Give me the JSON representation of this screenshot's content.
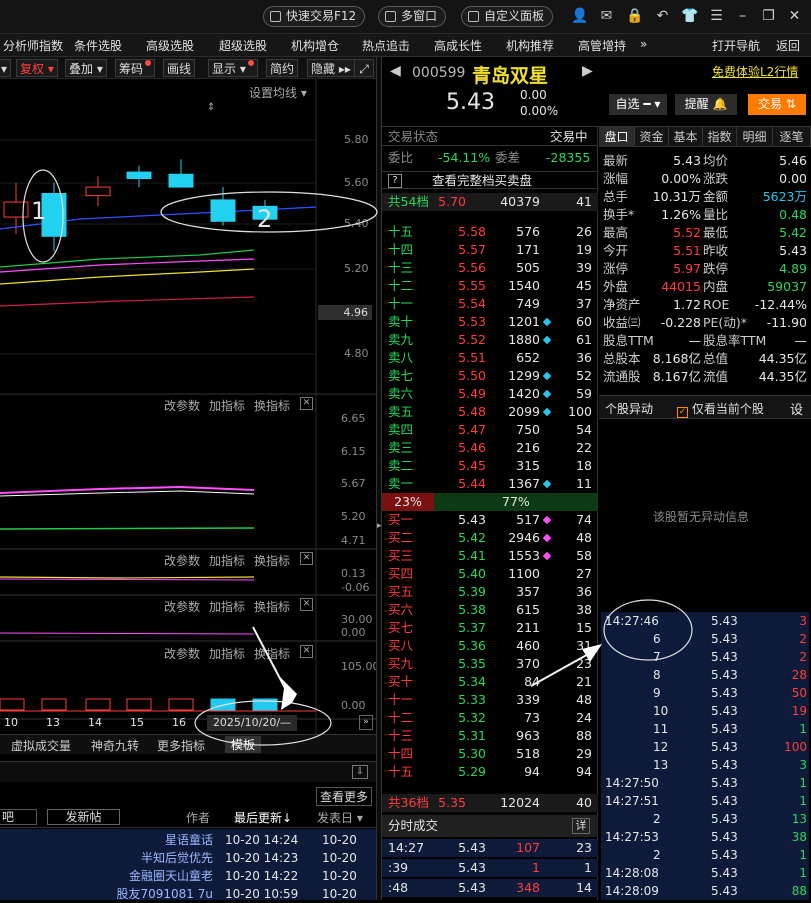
{
  "topbar": {
    "quick_trade": "快速交易F12",
    "multi_window": "多窗口",
    "custom_panel": "自定义面板"
  },
  "menu": {
    "items": [
      "分析师指数",
      "条件选股",
      "高级选股",
      "超级选股",
      "机构增仓",
      "热点追击",
      "高成长性",
      "机构推荐",
      "高管增持"
    ],
    "more": "»",
    "open_nav": "打开导航",
    "back": "返回"
  },
  "charttool": {
    "fq": "复权",
    "overlay": "叠加",
    "chip": "筹码",
    "draw": "画线",
    "display": "显示",
    "simple": "简约",
    "hide": "隐藏",
    "settings_ma": "设置均线"
  },
  "chart": {
    "price_ticks": [
      "5.80",
      "5.60",
      "5.40",
      "5.20",
      "5.00",
      "4.80"
    ],
    "current_price_tag": "4.96",
    "annot1": "1",
    "annot2": "2",
    "panel_buttons": {
      "params": "改参数",
      "add_indicator": "加指标",
      "switch_indicator": "换指标",
      "close": "✕"
    },
    "p2_ticks": [
      "6.65",
      "6.15",
      "5.67",
      "5.20",
      "4.71"
    ],
    "p3_ticks": [
      "0.13",
      "-0.06"
    ],
    "p4_ticks": [
      "30.00",
      "0.00"
    ],
    "p5_ticks": [
      "105.00",
      "0.00"
    ],
    "x_labels": [
      "10",
      "13",
      "14",
      "15",
      "16"
    ],
    "date_tag": "2025/10/20/—",
    "bottom_tabs": [
      "虚拟成交量",
      "神奇九转",
      "更多指标",
      "模板"
    ],
    "candles": [
      {
        "o": 5.44,
        "c": 5.51,
        "h": 5.6,
        "l": 5.36
      },
      {
        "o": 5.55,
        "c": 5.35,
        "h": 5.6,
        "l": 5.28
      },
      {
        "o": 5.54,
        "c": 5.58,
        "h": 5.63,
        "l": 5.49
      },
      {
        "o": 5.65,
        "c": 5.62,
        "h": 5.68,
        "l": 5.58
      },
      {
        "o": 5.64,
        "c": 5.58,
        "h": 5.71,
        "l": 5.58
      },
      {
        "o": 5.52,
        "c": 5.42,
        "h": 5.58,
        "l": 5.4
      },
      {
        "o": 5.49,
        "c": 5.43,
        "h": 5.52,
        "l": 5.42
      }
    ]
  },
  "stock": {
    "code": "000599",
    "name": "青岛双星",
    "price": "5.43",
    "change": "0.00",
    "pct": "0.00%",
    "l2": "免费体验L2行情",
    "watch": "自选",
    "remind": "提醒",
    "trade": "交易"
  },
  "ob": {
    "status_label": "交易状态",
    "status_val": "交易中",
    "weibi_label": "委比",
    "weibi": "-54.11%",
    "weicha_label": "委差",
    "weicha": "-28355",
    "full_link": "查看完整档买卖盘",
    "ask_total": {
      "label": "共54档",
      "price": "5.70",
      "vol": "40379",
      "n": "41"
    },
    "asks": [
      [
        "十五",
        "5.58",
        "576",
        "26"
      ],
      [
        "十四",
        "5.57",
        "171",
        "19"
      ],
      [
        "十三",
        "5.56",
        "505",
        "39"
      ],
      [
        "十二",
        "5.55",
        "1540",
        "45"
      ],
      [
        "十一",
        "5.54",
        "749",
        "37"
      ],
      [
        "卖十",
        "5.53",
        "1201",
        "60"
      ],
      [
        "卖九",
        "5.52",
        "1880",
        "61"
      ],
      [
        "卖八",
        "5.51",
        "652",
        "36"
      ],
      [
        "卖七",
        "5.50",
        "1299",
        "52"
      ],
      [
        "卖六",
        "5.49",
        "1420",
        "59"
      ],
      [
        "卖五",
        "5.48",
        "2099",
        "100"
      ],
      [
        "卖四",
        "5.47",
        "750",
        "54"
      ],
      [
        "卖三",
        "5.46",
        "216",
        "22"
      ],
      [
        "卖二",
        "5.45",
        "315",
        "18"
      ],
      [
        "卖一",
        "5.44",
        "1367",
        "11"
      ]
    ],
    "ratio_bid": "23%",
    "ratio_ask": "77%",
    "bids": [
      [
        "买一",
        "5.43",
        "517",
        "74"
      ],
      [
        "买二",
        "5.42",
        "2946",
        "48"
      ],
      [
        "买三",
        "5.41",
        "1553",
        "58"
      ],
      [
        "买四",
        "5.40",
        "1100",
        "27"
      ],
      [
        "买五",
        "5.39",
        "357",
        "36"
      ],
      [
        "买六",
        "5.38",
        "615",
        "38"
      ],
      [
        "买七",
        "5.37",
        "211",
        "15"
      ],
      [
        "买八",
        "5.36",
        "460",
        "31"
      ],
      [
        "买九",
        "5.35",
        "370",
        "23"
      ],
      [
        "买十",
        "5.34",
        "84",
        "21"
      ],
      [
        "十一",
        "5.33",
        "339",
        "48"
      ],
      [
        "十二",
        "5.32",
        "73",
        "24"
      ],
      [
        "十三",
        "5.31",
        "963",
        "88"
      ],
      [
        "十四",
        "5.30",
        "518",
        "29"
      ],
      [
        "十五",
        "5.29",
        "94",
        "94"
      ]
    ],
    "bid_total": {
      "label": "共36档",
      "price": "5.35",
      "vol": "12024",
      "n": "40"
    },
    "fenshi_label": "分时成交",
    "fenshi_detail": "详",
    "fenshi": [
      [
        "14:27",
        "5.43",
        "107",
        "23"
      ],
      [
        ":39",
        "5.43",
        "1",
        "1"
      ],
      [
        ":48",
        "5.43",
        "348",
        "14"
      ]
    ]
  },
  "rp": {
    "tabs": [
      "盘口",
      "资金",
      "基本",
      "指数",
      "明细",
      "逐笔"
    ],
    "quotes": [
      [
        "最新",
        "5.43",
        "均价",
        "5.46"
      ],
      [
        "涨幅",
        "0.00%",
        "涨跌",
        "0.00"
      ],
      [
        "总手",
        "10.31万",
        "金额",
        "5623万"
      ],
      [
        "换手*",
        "1.26%",
        "量比",
        "0.48"
      ],
      [
        "最高",
        "5.52",
        "最低",
        "5.42"
      ],
      [
        "今开",
        "5.51",
        "昨收",
        "5.43"
      ],
      [
        "涨停",
        "5.97",
        "跌停",
        "4.89"
      ],
      [
        "外盘",
        "44015",
        "内盘",
        "59037"
      ],
      [
        "净资产",
        "1.72",
        "ROE",
        "-12.44%"
      ],
      [
        "收益㈢",
        "-0.228",
        "PE(动)*",
        "-11.90"
      ],
      [
        "股息TTM",
        "—",
        "股息率TTM",
        "—"
      ],
      [
        "总股本",
        "8.168亿",
        "总值",
        "44.35亿"
      ],
      [
        "流通股",
        "8.167亿",
        "流值",
        "44.35亿"
      ]
    ],
    "abn_title": "个股异动",
    "abn_only": "仅看当前个股",
    "abn_set": "设",
    "abn_empty": "该股暂无异动信息",
    "ticks": [
      [
        "14:27:46",
        "5.43",
        "3"
      ],
      [
        "6",
        "5.43",
        "2"
      ],
      [
        "7",
        "5.43",
        "2"
      ],
      [
        "8",
        "5.43",
        "28"
      ],
      [
        "9",
        "5.43",
        "50"
      ],
      [
        "10",
        "5.43",
        "19"
      ],
      [
        "11",
        "5.43",
        "1"
      ],
      [
        "12",
        "5.43",
        "100"
      ],
      [
        "13",
        "5.43",
        "3"
      ],
      [
        "14:27:50",
        "5.43",
        "1"
      ],
      [
        "14:27:51",
        "5.43",
        "1"
      ],
      [
        "2",
        "5.43",
        "13"
      ],
      [
        "14:27:53",
        "5.43",
        "38"
      ],
      [
        "2",
        "5.43",
        "1"
      ],
      [
        "14:28:08",
        "5.43",
        "1"
      ],
      [
        "14:28:09",
        "5.43",
        "88"
      ]
    ]
  },
  "bottom": {
    "view_more": "查看更多",
    "post_btn": "发新帖",
    "bar_tag": "吧",
    "cols": [
      "作者",
      "最后更新",
      "发表日"
    ],
    "posts": [
      [
        "星语童话",
        "10-20 14:24",
        "10-20"
      ],
      [
        "半知后觉优先",
        "10-20 14:23",
        "10-20"
      ],
      [
        "金融圈天山童老",
        "10-20 14:22",
        "10-20"
      ],
      [
        "股友7091081 7u",
        "10-20 10:59",
        "10-20"
      ]
    ]
  }
}
